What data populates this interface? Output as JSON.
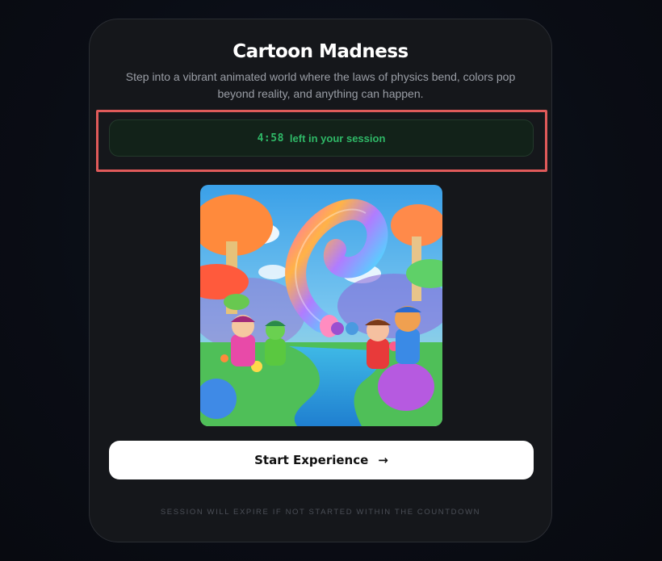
{
  "card": {
    "title": "Cartoon Madness",
    "subtitle": "Step into a vibrant animated world where the laws of physics bend, colors pop beyond reality, and anything can happen."
  },
  "timer": {
    "time": "4:58",
    "label": "left in your session",
    "color": "#2fb867"
  },
  "actions": {
    "start_label": "Start Experience",
    "start_icon": "arrow-right-icon"
  },
  "footer": {
    "note": "SESSION WILL EXPIRE IF NOT STARTED WITHIN THE COUNTDOWN"
  },
  "colors": {
    "background": "#0a0d15",
    "card": "#15171b",
    "highlight_border": "#e05a5a"
  }
}
